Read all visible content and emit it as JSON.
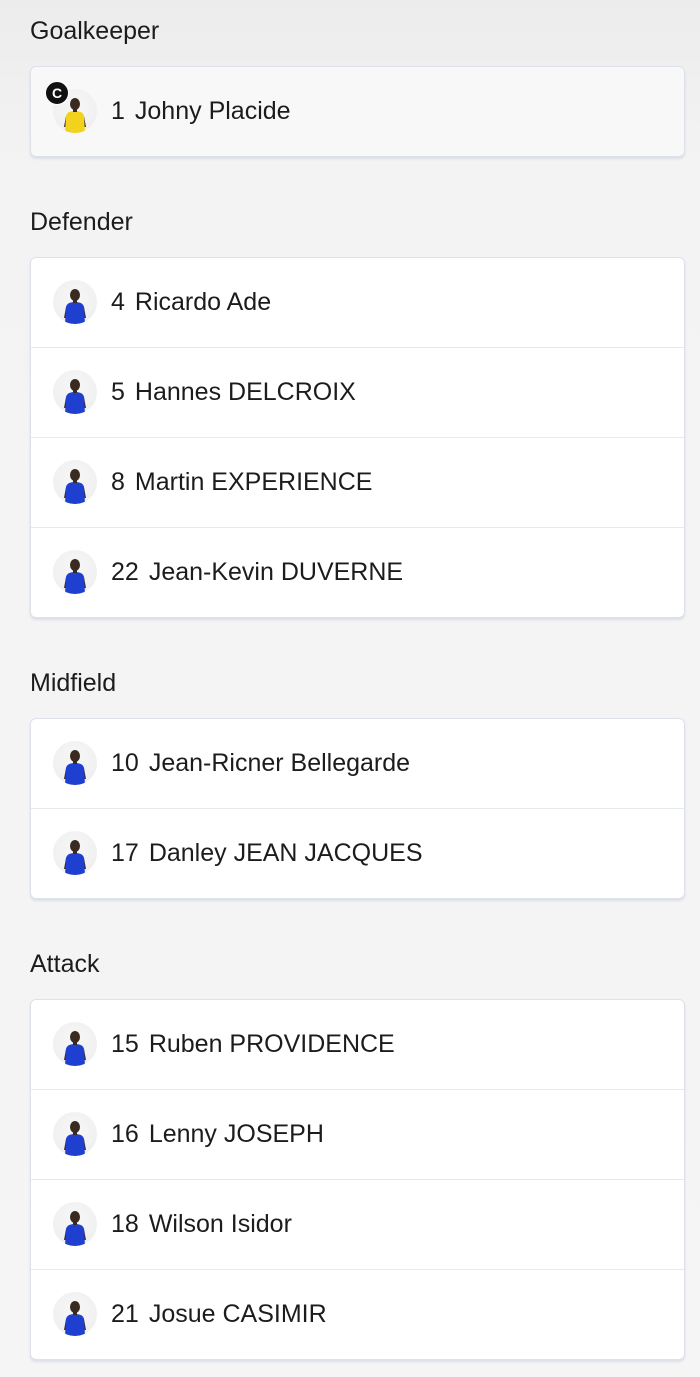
{
  "sections": [
    {
      "title": "Goalkeeper",
      "players": [
        {
          "number": "1",
          "name": "Johny Placide",
          "captain": true,
          "kit_color": "#f2d21c",
          "captain_label": "C"
        }
      ]
    },
    {
      "title": "Defender",
      "players": [
        {
          "number": "4",
          "name": "Ricardo Ade",
          "kit_color": "#1e3fd0"
        },
        {
          "number": "5",
          "name": "Hannes DELCROIX",
          "kit_color": "#1e3fd0"
        },
        {
          "number": "8",
          "name": "Martin EXPERIENCE",
          "kit_color": "#1e3fd0"
        },
        {
          "number": "22",
          "name": "Jean-Kevin DUVERNE",
          "kit_color": "#1e3fd0"
        }
      ]
    },
    {
      "title": "Midfield",
      "players": [
        {
          "number": "10",
          "name": "Jean-Ricner Bellegarde",
          "kit_color": "#1e3fd0"
        },
        {
          "number": "17",
          "name": "Danley JEAN JACQUES",
          "kit_color": "#1e3fd0"
        }
      ]
    },
    {
      "title": "Attack",
      "players": [
        {
          "number": "15",
          "name": "Ruben PROVIDENCE",
          "kit_color": "#1e3fd0"
        },
        {
          "number": "16",
          "name": "Lenny JOSEPH",
          "kit_color": "#1e3fd0"
        },
        {
          "number": "18",
          "name": "Wilson Isidor",
          "kit_color": "#1e3fd0"
        },
        {
          "number": "21",
          "name": "Josue CASIMIR",
          "kit_color": "#1e3fd0"
        }
      ]
    }
  ],
  "icons": {
    "player_avatar": "player-photo-icon",
    "captain": "captain-badge-icon"
  }
}
